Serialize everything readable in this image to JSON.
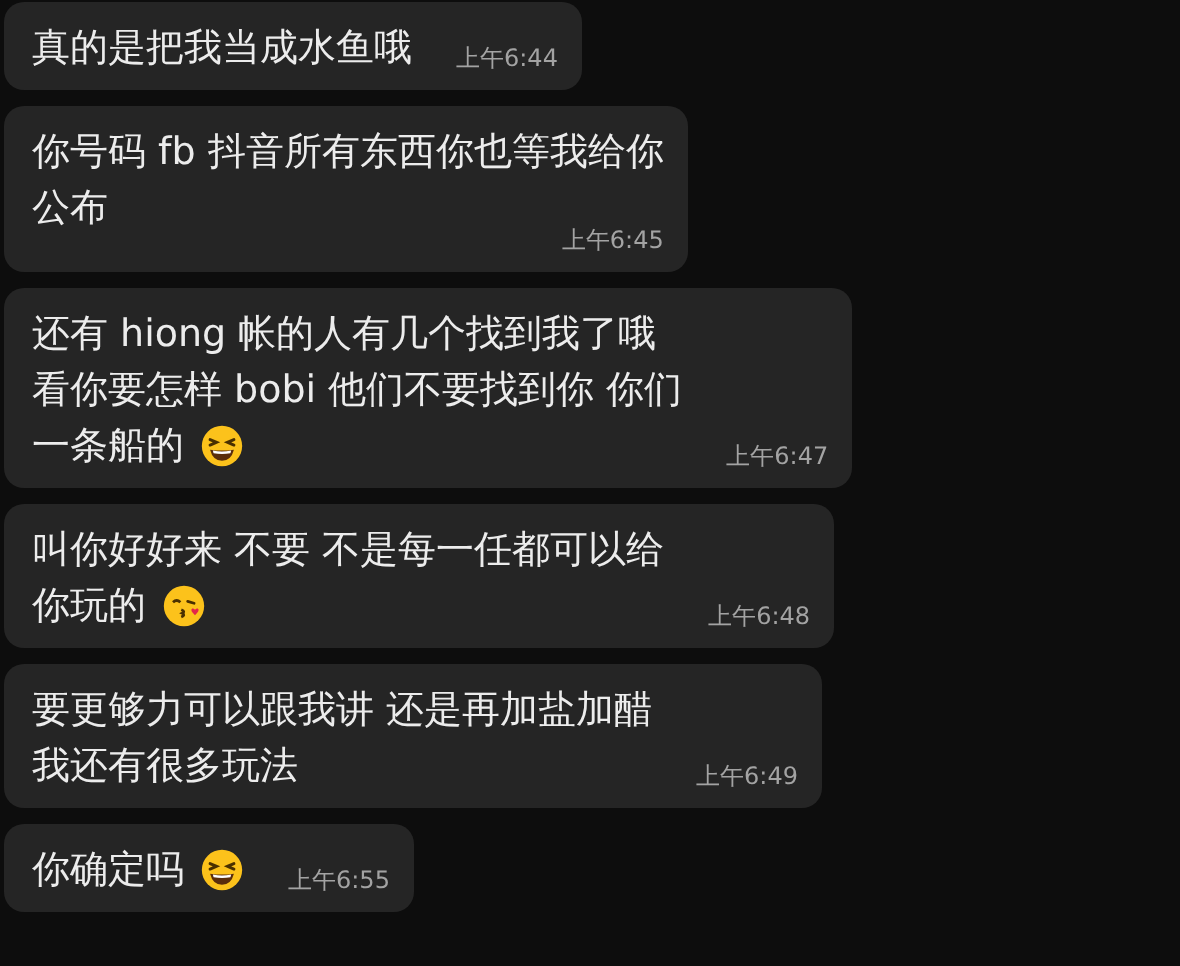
{
  "messages": [
    {
      "lines": [
        "真的是把我当成水鱼哦"
      ],
      "time": "上午6:44",
      "kind": "side"
    },
    {
      "lines": [
        "你号码 fb 抖音所有东西你也等我给你",
        "公布"
      ],
      "time": "上午6:45",
      "kind": "stacked"
    },
    {
      "lines": [
        "还有 hiong 帐的人有几个找到我了哦",
        "看你要怎样 bobi 他们不要找到你 你们",
        "一条船的"
      ],
      "emoji": {
        "kind": "grin"
      },
      "time": "上午6:47",
      "kind": "side"
    },
    {
      "lines": [
        "叫你好好来 不要 不是每一任都可以给",
        "你玩的"
      ],
      "emoji": {
        "kind": "kiss"
      },
      "time": "上午6:48",
      "kind": "side"
    },
    {
      "lines": [
        "要更够力可以跟我讲 还是再加盐加醋",
        "我还有很多玩法"
      ],
      "time": "上午6:49",
      "kind": "side"
    },
    {
      "lines": [
        "你确定吗"
      ],
      "emoji": {
        "kind": "grin"
      },
      "time": "上午6:55",
      "kind": "side"
    }
  ]
}
